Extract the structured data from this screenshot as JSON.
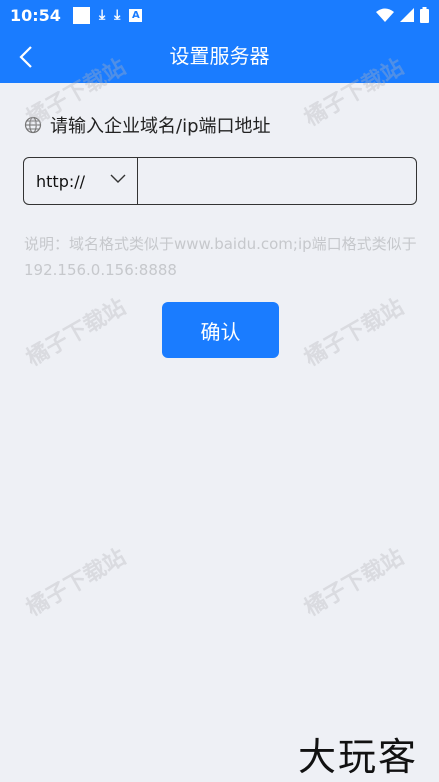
{
  "status_bar": {
    "time": "10:54"
  },
  "header": {
    "title": "设置服务器",
    "back_icon": "chevron-left-icon"
  },
  "form": {
    "prompt": "请输入企业域名/ip端口地址",
    "protocol_value": "http://",
    "address_value": "",
    "hint": "说明：域名格式类似于www.baidu.com;ip端口格式类似于192.156.0.156:8888",
    "confirm_label": "确认"
  },
  "watermarks": [
    "橘子下载站",
    "橘子下载站",
    "橘子下载站",
    "橘子下载站",
    "橘子下载站",
    "橘子下载站"
  ],
  "corner_logo": "大玩客",
  "colors": {
    "accent": "#1a7cff",
    "background": "#eef0f5",
    "hint": "#c6c8cc"
  }
}
